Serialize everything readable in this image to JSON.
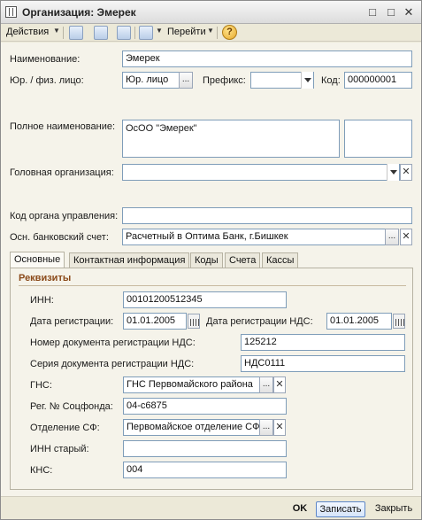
{
  "window": {
    "title": "Организация: Эмерек"
  },
  "toolbar": {
    "actions_label": "Действия",
    "goto_label": "Перейти"
  },
  "form": {
    "name_label": "Наименование:",
    "name_value": "Эмерек",
    "legal_label": "Юр. / физ. лицо:",
    "legal_value": "Юр. лицо",
    "prefix_label": "Префикс:",
    "prefix_value": "",
    "code_label": "Код:",
    "code_value": "000000001",
    "fullname_label": "Полное наименование:",
    "fullname_value": "ОсОО \"Эмерек\"",
    "head_org_label": "Головная организация:",
    "head_org_value": "",
    "gov_code_label": "Код органа управления:",
    "gov_code_value": "",
    "bank_label": "Осн. банковский счет:",
    "bank_value": "Расчетный в Оптима Банк, г.Бишкек"
  },
  "tabs": [
    {
      "label": "Основные",
      "active": true
    },
    {
      "label": "Контактная информация",
      "active": false
    },
    {
      "label": "Коды",
      "active": false
    },
    {
      "label": "Счета",
      "active": false
    },
    {
      "label": "Кассы",
      "active": false
    }
  ],
  "details": {
    "section_title": "Реквизиты",
    "inn_label": "ИНН:",
    "inn_value": "00101200512345",
    "reg_date_label": "Дата регистрации:",
    "reg_date_value": "01.01.2005",
    "vat_reg_date_label": "Дата регистрации НДС:",
    "vat_reg_date_value": "01.01.2005",
    "vat_doc_number_label": "Номер документа регистрации НДС:",
    "vat_doc_number_value": "125212",
    "vat_doc_series_label": "Серия документа регистрации НДС:",
    "vat_doc_series_value": "НДС0111",
    "gns_label": "ГНС:",
    "gns_value": "ГНС Первомайского района",
    "socfund_label": "Рег. № Соцфонда:",
    "socfund_value": "04-с6875",
    "sf_dept_label": "Отделение СФ:",
    "sf_dept_value": "Первомайское отделение СФ",
    "old_inn_label": "ИНН старый:",
    "old_inn_value": "",
    "kns_label": "КНС:",
    "kns_value": "004"
  },
  "footer": {
    "ok_label": "OK",
    "save_label": "Записать",
    "close_label": "Закрыть"
  }
}
